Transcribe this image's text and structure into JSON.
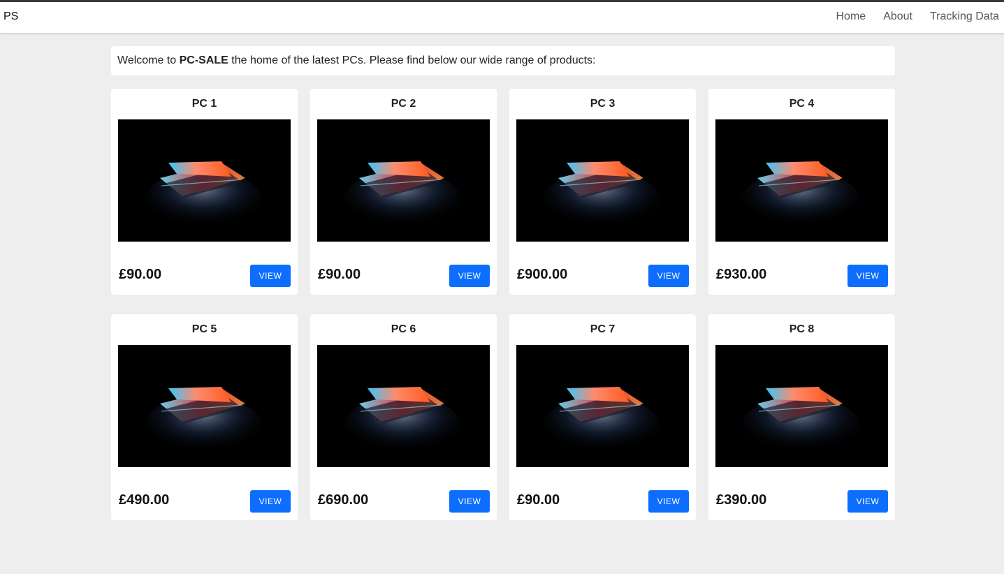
{
  "navbar": {
    "brand": "PS",
    "links": [
      "Home",
      "About",
      "Tracking Data"
    ]
  },
  "welcome": {
    "prefix": "Welcome to ",
    "brand": "PC-SALE",
    "suffix": " the home of the latest PCs. Please find below our wide range of products:"
  },
  "products": [
    {
      "name": "PC 1",
      "price": "£90.00",
      "button": "VIEW"
    },
    {
      "name": "PC 2",
      "price": "£90.00",
      "button": "VIEW"
    },
    {
      "name": "PC 3",
      "price": "£900.00",
      "button": "VIEW"
    },
    {
      "name": "PC 4",
      "price": "£930.00",
      "button": "VIEW"
    },
    {
      "name": "PC 5",
      "price": "£490.00",
      "button": "VIEW"
    },
    {
      "name": "PC 6",
      "price": "£690.00",
      "button": "VIEW"
    },
    {
      "name": "PC 7",
      "price": "£90.00",
      "button": "VIEW"
    },
    {
      "name": "PC 8",
      "price": "£390.00",
      "button": "VIEW"
    }
  ],
  "colors": {
    "accent": "#0d6efd",
    "page_background": "#eeeeee"
  }
}
